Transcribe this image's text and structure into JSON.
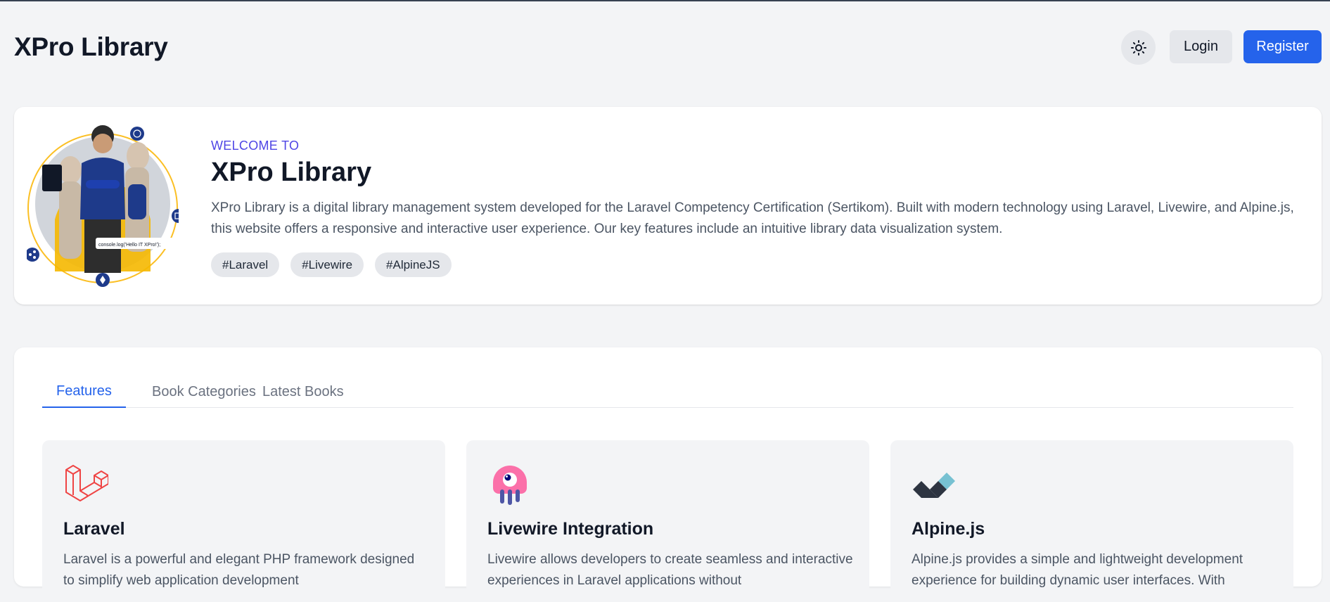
{
  "header": {
    "brand": "XPro Library",
    "theme_icon": "sun-icon",
    "login_label": "Login",
    "register_label": "Register"
  },
  "hero": {
    "image_caption": "console.log('Hello IT XPro!');",
    "welcome": "WELCOME TO",
    "title": "XPro Library",
    "description": "XPro Library is a digital library management system developed for the Laravel Competency Certification (Sertikom). Built with modern technology using Laravel, Livewire, and Alpine.js, this website offers a responsive and interactive user experience. Our key features include an intuitive library data visualization system.",
    "tags": [
      "#Laravel",
      "#Livewire",
      "#AlpineJS"
    ]
  },
  "tabs": [
    {
      "label": "Features",
      "active": true
    },
    {
      "label": "Book Categories",
      "active": false
    },
    {
      "label": "Latest Books",
      "active": false
    }
  ],
  "features": [
    {
      "icon": "laravel-icon",
      "title": "Laravel",
      "description": "Laravel is a powerful and elegant PHP framework designed to simplify web application development"
    },
    {
      "icon": "livewire-icon",
      "title": "Livewire Integration",
      "description": "Livewire allows developers to create seamless and interactive experiences in Laravel applications without"
    },
    {
      "icon": "alpinejs-icon",
      "title": "Alpine.js",
      "description": "Alpine.js provides a simple and lightweight development experience for building dynamic user interfaces. With"
    }
  ],
  "colors": {
    "accent": "#2563eb",
    "welcome": "#4f46e5",
    "laravel": "#ef4444",
    "livewire": "#fb70a9",
    "alpine_dark": "#2d3441",
    "alpine_light": "#77c1d2"
  }
}
